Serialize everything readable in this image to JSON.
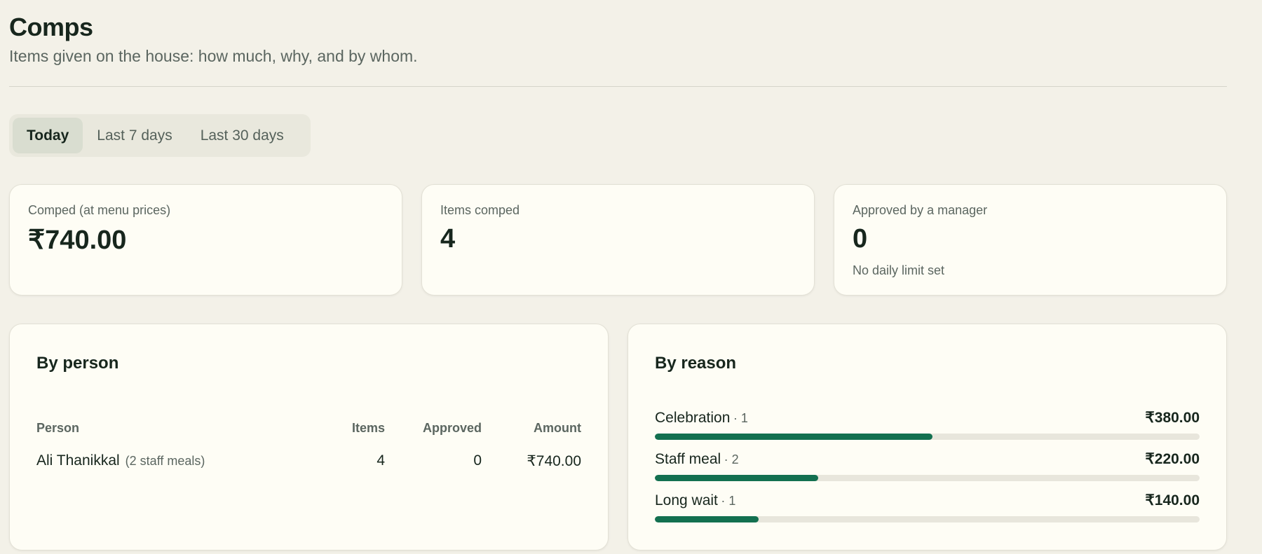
{
  "header": {
    "title": "Comps",
    "subtitle": "Items given on the house: how much, why, and by whom."
  },
  "range_tabs": [
    {
      "label": "Today",
      "active": true
    },
    {
      "label": "Last 7 days",
      "active": false
    },
    {
      "label": "Last 30 days",
      "active": false
    }
  ],
  "stats": {
    "comped": {
      "label": "Comped (at menu prices)",
      "value": "₹740.00"
    },
    "items": {
      "label": "Items comped",
      "value": "4"
    },
    "approved": {
      "label": "Approved by a manager",
      "value": "0",
      "note": "No daily limit set"
    }
  },
  "by_person": {
    "title": "By person",
    "columns": {
      "person": "Person",
      "items": "Items",
      "approved": "Approved",
      "amount": "Amount"
    },
    "rows": [
      {
        "name": "Ali Thanikkal",
        "note": "(2 staff meals)",
        "items": "4",
        "approved": "0",
        "amount": "₹740.00"
      }
    ]
  },
  "by_reason": {
    "title": "By reason",
    "items": [
      {
        "name": "Celebration",
        "count": "· 1",
        "amount": "₹380.00",
        "share": 0.51
      },
      {
        "name": "Staff meal",
        "count": "· 2",
        "amount": "₹220.00",
        "share": 0.3
      },
      {
        "name": "Long wait",
        "count": "· 1",
        "amount": "₹140.00",
        "share": 0.19
      }
    ]
  },
  "colors": {
    "background": "#f3f1e8",
    "card": "#fefdf5",
    "accent_bar": "#137050",
    "bar_track": "#e8e6dc",
    "active_tab": "#d9ddd0"
  }
}
